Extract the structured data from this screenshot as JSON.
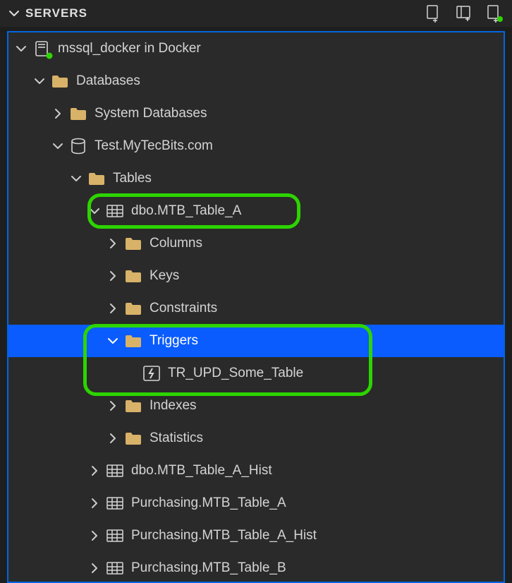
{
  "panel": {
    "title": "SERVERS"
  },
  "tree": {
    "server": "mssql_docker in Docker",
    "databases": "Databases",
    "system_databases": "System Databases",
    "db_name": "Test.MyTecBits.com",
    "tables": "Tables",
    "table_a": "dbo.MTB_Table_A",
    "columns": "Columns",
    "keys": "Keys",
    "constraints": "Constraints",
    "triggers": "Triggers",
    "trigger_1": "TR_UPD_Some_Table",
    "indexes": "Indexes",
    "statistics": "Statistics",
    "table_a_hist": "dbo.MTB_Table_A_Hist",
    "purch_a": "Purchasing.MTB_Table_A",
    "purch_a_hist": "Purchasing.MTB_Table_A_Hist",
    "purch_b": "Purchasing.MTB_Table_B"
  }
}
